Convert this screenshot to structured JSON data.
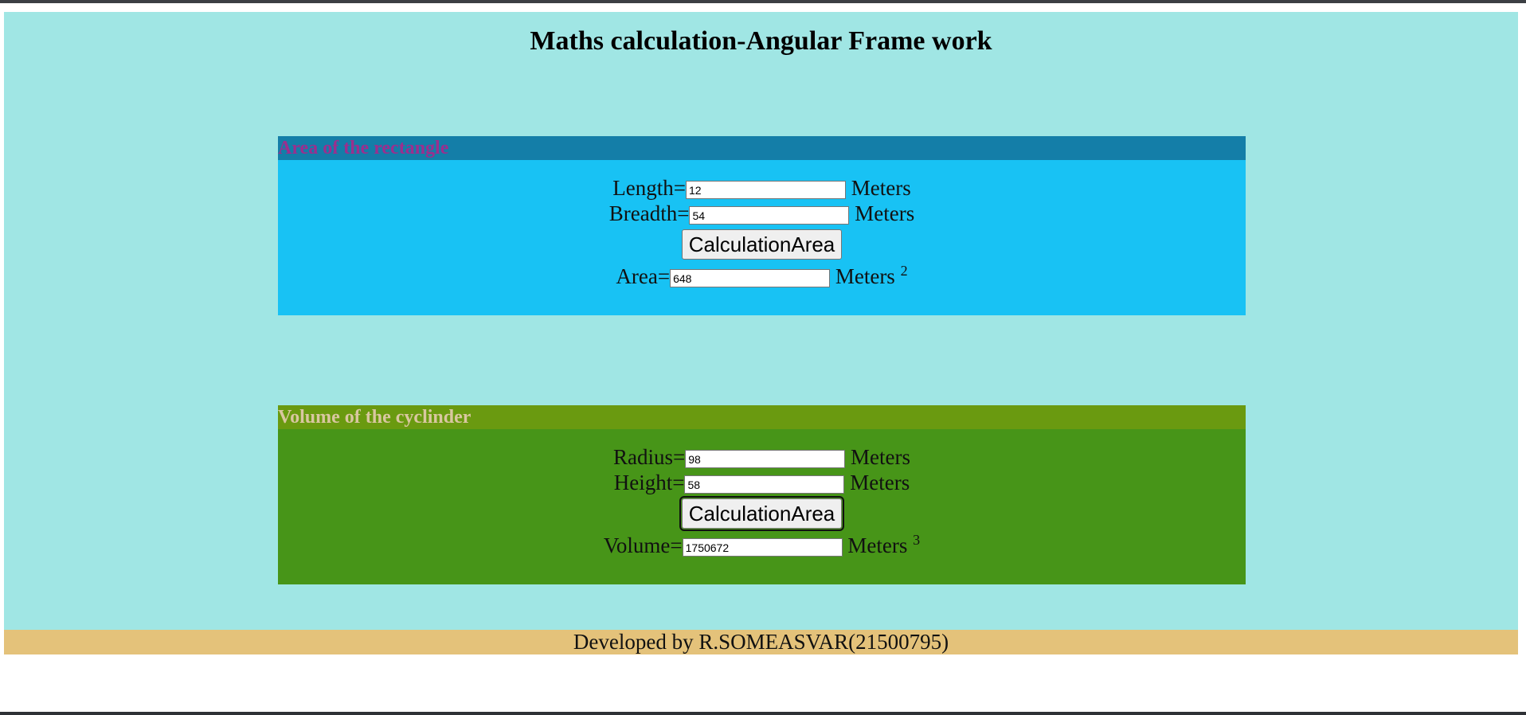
{
  "page": {
    "title": "Maths calculation-Angular Frame work",
    "footer": "Developed by R.SOMEASVAR(21500795)"
  },
  "rectangle": {
    "heading": "Area of the rectangle",
    "length_label": "Length=",
    "length_value": "12",
    "breadth_label": "Breadth=",
    "breadth_value": "54",
    "unit": "Meters",
    "button_label": "CalculationArea",
    "area_label": "Area=",
    "area_value": "648",
    "area_unit": "Meters",
    "area_exponent": "2"
  },
  "cylinder": {
    "heading": "Volume of the cyclinder",
    "radius_label": "Radius=",
    "radius_value": "98",
    "height_label": "Height=",
    "height_value": "58",
    "unit": "Meters",
    "button_label": "CalculationArea",
    "volume_label": "Volume=",
    "volume_value": "1750672",
    "volume_unit": "Meters",
    "volume_exponent": "3"
  },
  "colors": {
    "page_bg": "#a0e6e4",
    "rect_head_bg": "#147ea8",
    "rect_head_text": "#9b2f8e",
    "rect_body_bg": "#18c2f4",
    "cyl_head_bg": "#6a9a10",
    "cyl_head_text": "#d9c7a0",
    "cyl_body_bg": "#479518",
    "footer_bg": "#e4c27a"
  }
}
